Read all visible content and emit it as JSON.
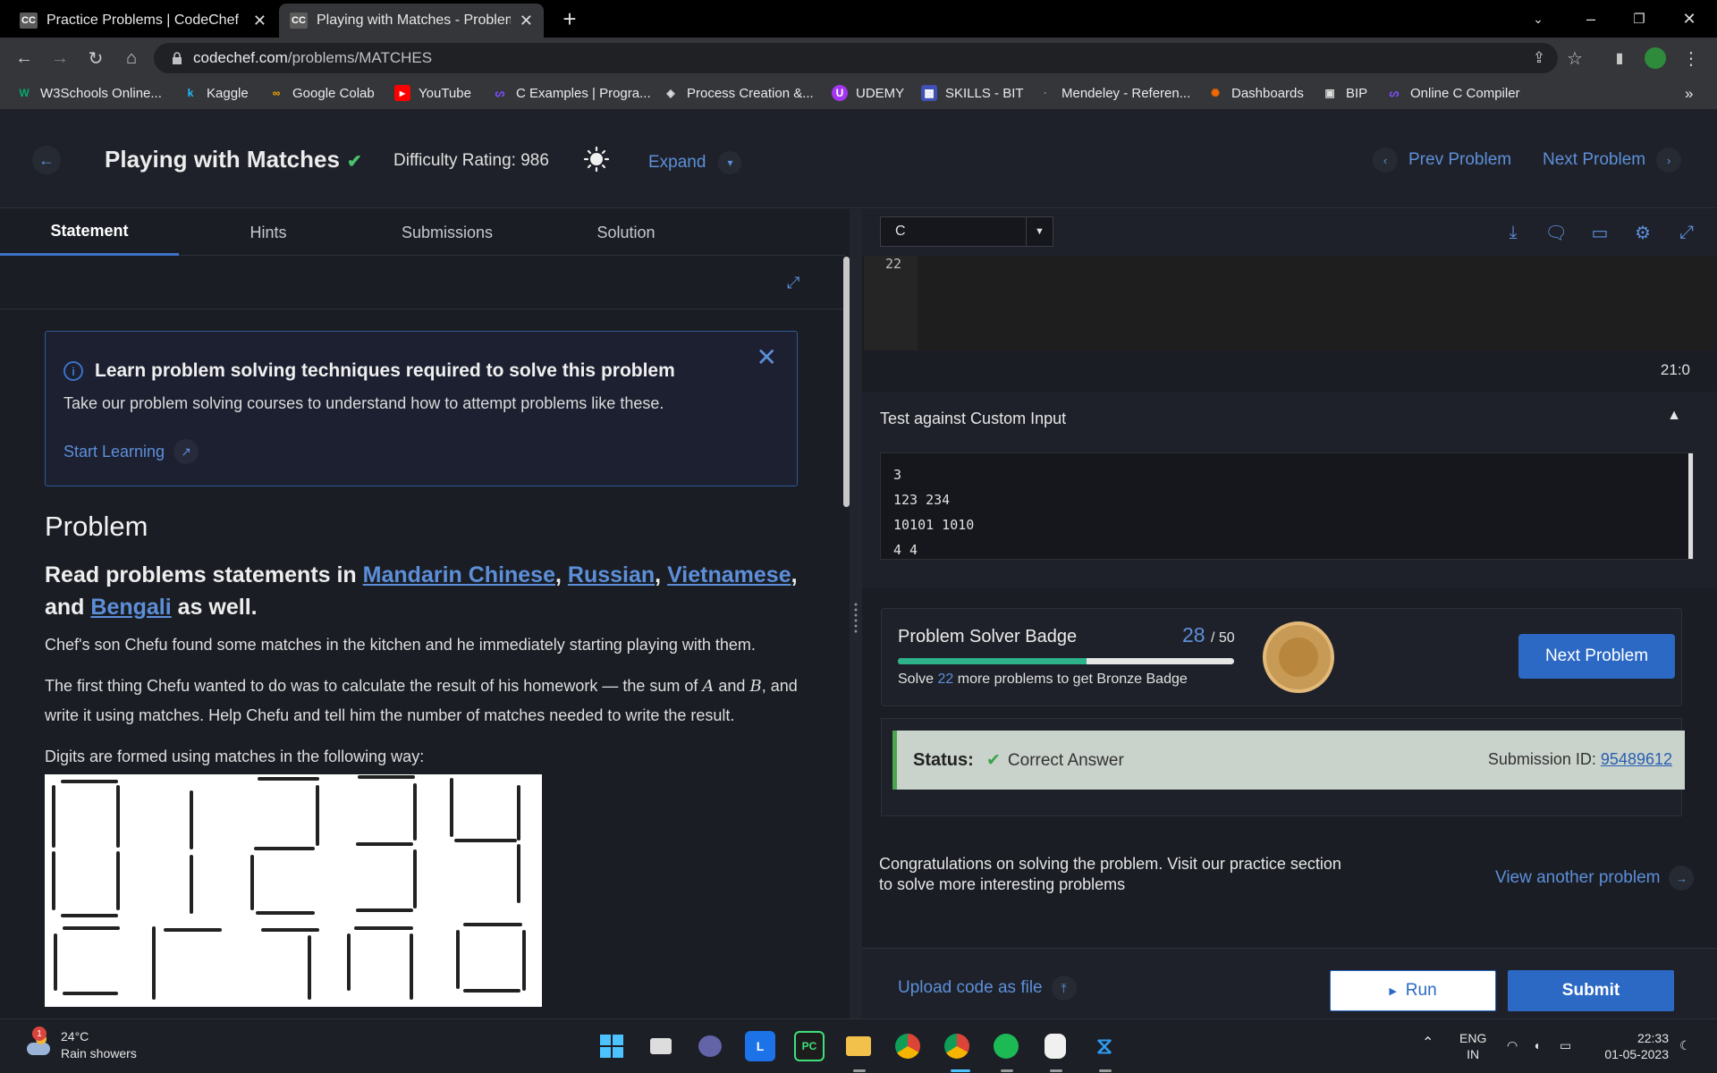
{
  "browser": {
    "tabs": [
      {
        "icon": "CC",
        "title": "Practice Problems | CodeChef"
      },
      {
        "icon": "CC",
        "title": "Playing with Matches - Problems"
      }
    ],
    "url_domain": "codechef.com",
    "url_path": "/problems/MATCHES",
    "bookmarks": [
      {
        "label": "W3Schools Online...",
        "icon": "w3schools-icon",
        "color": "#04aa6d"
      },
      {
        "label": "Kaggle",
        "icon": "kaggle-icon",
        "color": "#20beff"
      },
      {
        "label": "Google Colab",
        "icon": "colab-icon",
        "color": "#f9ab00"
      },
      {
        "label": "YouTube",
        "icon": "youtube-icon",
        "color": "#ff0000"
      },
      {
        "label": "C Examples | Progra...",
        "icon": "programiz-icon",
        "color": "#7c4dff"
      },
      {
        "label": "Process Creation &...",
        "icon": "process-icon",
        "color": "#dddddd"
      },
      {
        "label": "UDEMY",
        "icon": "udemy-icon",
        "color": "#a435f0"
      },
      {
        "label": "SKILLS - BIT",
        "icon": "skills-icon",
        "color": "#3f51b5"
      },
      {
        "label": "Mendeley - Referen...",
        "icon": "mendeley-icon",
        "color": "#444444"
      },
      {
        "label": "Dashboards",
        "icon": "grafana-icon",
        "color": "#f46800"
      },
      {
        "label": "BIP",
        "icon": "bip-icon",
        "color": "#dddddd"
      },
      {
        "label": "Online C Compiler",
        "icon": "programiz-icon",
        "color": "#7c4dff"
      }
    ],
    "more_bookmarks": "»"
  },
  "header": {
    "title": "Playing with Matches",
    "difficulty": "Difficulty Rating: 986",
    "expand": "Expand",
    "prev": "Prev Problem",
    "next": "Next Problem"
  },
  "left_tabs": [
    "Statement",
    "Hints",
    "Submissions",
    "Solution"
  ],
  "learn": {
    "heading": "Learn problem solving techniques required to solve this problem",
    "body": "Take our problem solving courses to understand how to attempt problems like these.",
    "cta": "Start Learning"
  },
  "problem": {
    "heading": "Problem",
    "read_prefix": "Read problems statements in",
    "langs": [
      "Mandarin Chinese",
      "Russian",
      "Vietnamese",
      "Bengali"
    ],
    "sep1": ",",
    "sep2": ",",
    "sep3": ", and",
    "read_suffix": "as well.",
    "p1": "Chef's son Chefu found some matches in the kitchen and he immediately starting playing with them.",
    "p2_a": "The first thing Chefu wanted to do was to calculate the result of his homework — the sum of",
    "var_a": "A",
    "p2_and": "and",
    "var_b": "B",
    "p2_b": ", and write it using matches. Help Chefu and tell him the number of matches needed to write the result.",
    "p3": "Digits are formed using matches in the following way:"
  },
  "editor": {
    "language": "C",
    "line_number": "22",
    "cursor": "21:0"
  },
  "custom_input": {
    "title": "Test against Custom Input",
    "lines": [
      "3",
      "123 234",
      "10101 1010",
      "4 4"
    ]
  },
  "badge": {
    "title": "Problem Solver Badge",
    "solved": "28",
    "total": "/ 50",
    "progress": 0.56,
    "sub_prefix": "Solve",
    "sub_count": "22",
    "sub_suffix": "more problems to get Bronze Badge",
    "next_button": "Next Problem"
  },
  "status": {
    "label": "Status:",
    "value": "Correct Answer",
    "submission_label": "Submission ID:",
    "submission_id": "95489612"
  },
  "congrats": {
    "line1": "Congratulations on solving the problem. Visit our practice section",
    "line2": "to solve more interesting problems",
    "view_another": "View another problem"
  },
  "actions": {
    "upload": "Upload code as file",
    "run": "Run",
    "submit": "Submit"
  },
  "taskbar": {
    "weather_temp": "24°C",
    "weather_desc": "Rain showers",
    "weather_badge": "1",
    "lang_top": "ENG",
    "lang_bottom": "IN",
    "time": "22:33",
    "date": "01-05-2023"
  },
  "colors": {
    "accent": "#5d8fd9",
    "primary_button": "#2b69c4",
    "success": "#48c26d",
    "progress": "#2db389"
  }
}
